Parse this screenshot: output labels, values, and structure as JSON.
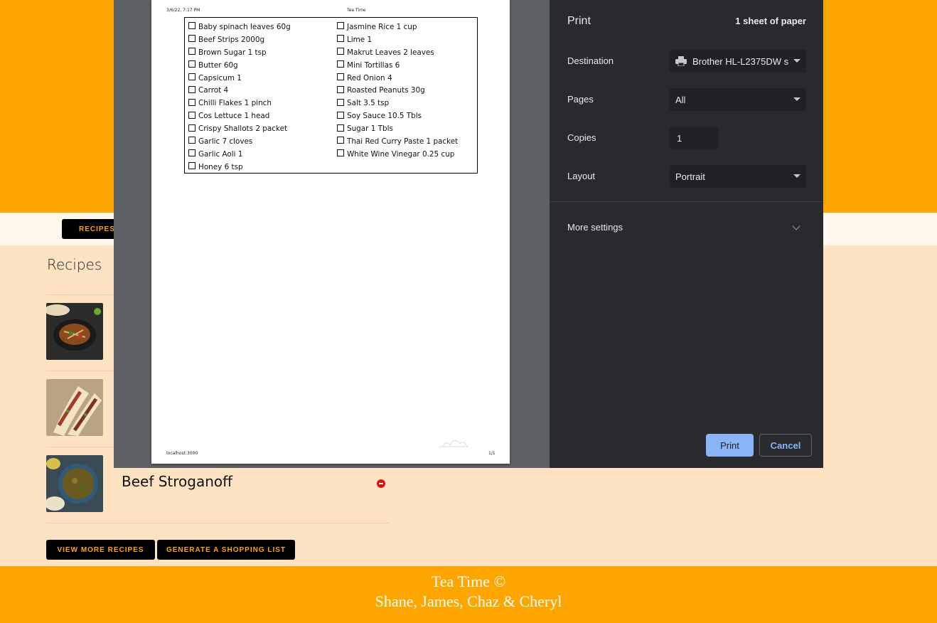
{
  "app": {
    "nav_recipes": "RECIPES",
    "recipes_heading": "Recipes",
    "recipes": [
      {
        "name": "",
        "thumb": "stir-fry-thumb"
      },
      {
        "name": "",
        "thumb": "tacos-thumb"
      },
      {
        "name": "Beef Stroganoff",
        "thumb": "stroganoff-thumb"
      }
    ],
    "view_more_label": "VIEW MORE RECIPES",
    "generate_list_label": "GENERATE A SHOPPING LIST",
    "footer_line1": "Tea Time ©",
    "footer_line2": "Shane, James, Chaz & Cheryl"
  },
  "preview": {
    "header_date": "3/6/22, 7:17 PM",
    "header_title": "Tea Time",
    "footer_url": "localhost:3000",
    "footer_page": "1/1",
    "left_column": [
      "Baby spinach leaves 60g",
      "Beef Strips 2000g",
      "Brown Sugar 1 tsp",
      "Butter 60g",
      "Capsicum 1",
      "Carrot 4",
      "Chilli Flakes 1 pinch",
      "Cos Lettuce 1 head",
      "Crispy Shallots 2 packet",
      "Garlic 7 cloves",
      "Garlic Aoli 1",
      "Honey 6 tsp"
    ],
    "right_column": [
      "Jasmine Rice 1 cup",
      "Lime 1",
      "Makrut Leaves 2 leaves",
      "Mini Tortillas 6",
      "Red Onion 4",
      "Roasted Peanuts 30g",
      "Salt 3.5 tsp",
      "Soy Sauce 10.5 Tbls",
      "Sugar 1 Tbls",
      "Thai Red Curry Paste 1 packet",
      "White Wine Vinegar 0.25 cup"
    ]
  },
  "print_dialog": {
    "title": "Print",
    "sheet_count": "1 sheet of paper",
    "destination_label": "Destination",
    "destination_value": "Brother HL-L2375DW s",
    "pages_label": "Pages",
    "pages_value": "All",
    "copies_label": "Copies",
    "copies_value": "1",
    "layout_label": "Layout",
    "layout_value": "Portrait",
    "more_settings_label": "More settings",
    "print_label": "Print",
    "cancel_label": "Cancel"
  },
  "colors": {
    "brand_orange": "#fea500",
    "page_peach": "#fde3c1",
    "dialog_bg": "#292a2d",
    "print_blue": "#8ab4f8",
    "remove_red": "#e01010"
  }
}
